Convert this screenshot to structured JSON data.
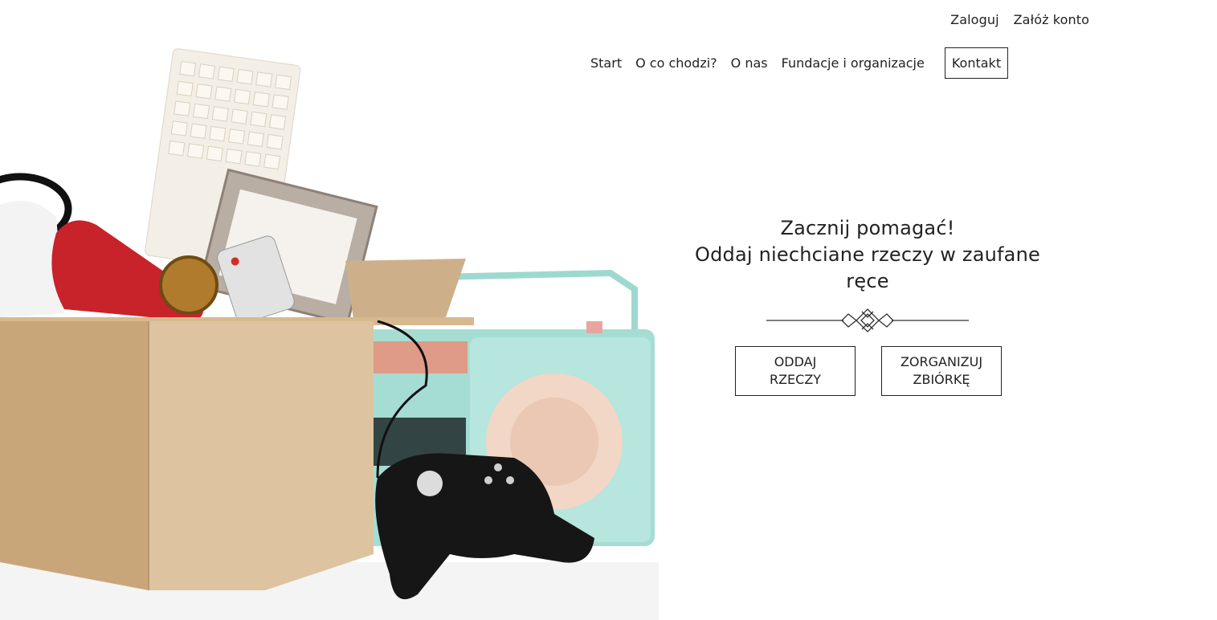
{
  "auth": {
    "login_label": "Zaloguj",
    "register_label": "Załóż konto"
  },
  "nav": {
    "items": [
      {
        "label": "Start"
      },
      {
        "label": "O co chodzi?"
      },
      {
        "label": "O nas"
      },
      {
        "label": "Fundacje i organizacje"
      },
      {
        "label": "Kontakt",
        "active": true
      }
    ]
  },
  "hero": {
    "heading_line1": "Zacznij pomagać!",
    "heading_line2": "Oddaj niechciane rzeczy w zaufane ręce",
    "buttons": {
      "give": "ODDAJ\nRZECZY",
      "organize": "ZORGANIZUJ\nZBIÓRKĘ"
    }
  },
  "colors": {
    "text": "#222222",
    "border": "#222222",
    "background": "#ffffff"
  }
}
